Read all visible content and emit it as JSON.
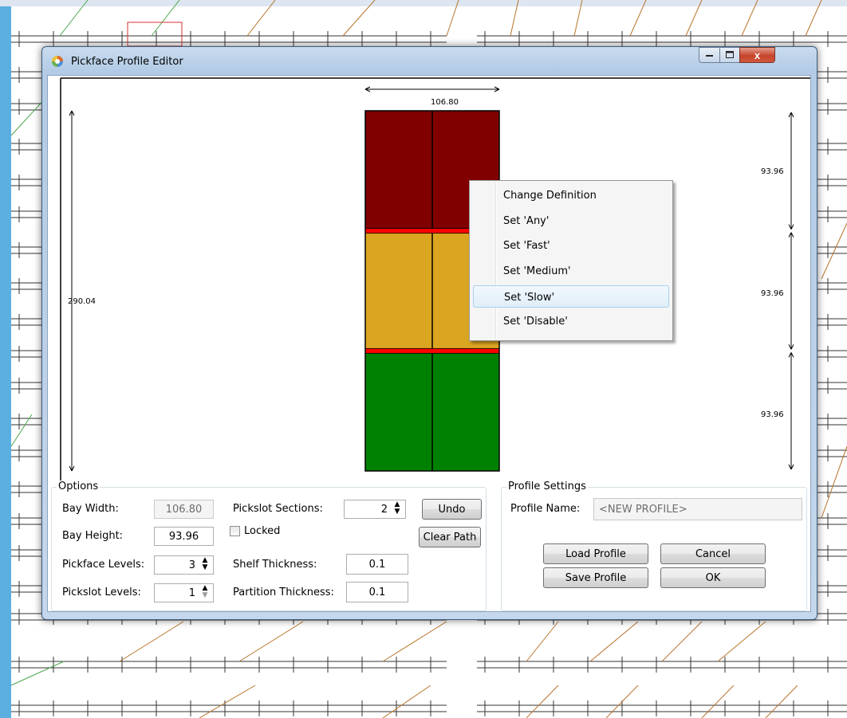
{
  "window": {
    "title": "Pickface Profile Editor",
    "icons": {
      "app": "app-icon",
      "minimize": "minimize-icon",
      "maximize": "maximize-icon",
      "close": "close-icon"
    },
    "close_glyph": "x"
  },
  "diagram": {
    "width_label": "106.80",
    "total_height_label": "290.04",
    "level_height_labels": [
      "93.96",
      "93.96",
      "93.96"
    ],
    "level_colors": [
      "#800000",
      "#DAA520",
      "#008000"
    ],
    "shelf_color": "#FF0000"
  },
  "context_menu": {
    "items": [
      "Change Definition",
      "Set 'Any'",
      "Set 'Fast'",
      "Set 'Medium'",
      "Set 'Slow'",
      "Set 'Disable'"
    ],
    "highlighted": "Set 'Slow'"
  },
  "options": {
    "group_title": "Options",
    "bay_width_label": "Bay Width:",
    "bay_width_value": "106.80",
    "bay_height_label": "Bay Height:",
    "bay_height_value": "93.96",
    "pickface_levels_label": "Pickface Levels:",
    "pickface_levels_value": "3",
    "pickslot_levels_label": "Pickslot Levels:",
    "pickslot_levels_value": "1",
    "pickslot_sections_label": "Pickslot Sections:",
    "pickslot_sections_value": "2",
    "locked_label": "Locked",
    "locked_checked": false,
    "shelf_thickness_label": "Shelf Thickness:",
    "shelf_thickness_value": "0.1",
    "partition_thickness_label": "Partition Thickness:",
    "partition_thickness_value": "0.1",
    "undo_label": "Undo",
    "clear_path_label": "Clear Path",
    "spin_up": "▲",
    "spin_down": "▼"
  },
  "profile_settings": {
    "group_title": "Profile Settings",
    "profile_name_label": "Profile Name:",
    "profile_name_value": "<NEW PROFILE>",
    "load_label": "Load Profile",
    "cancel_label": "Cancel",
    "save_label": "Save Profile",
    "ok_label": "OK"
  }
}
